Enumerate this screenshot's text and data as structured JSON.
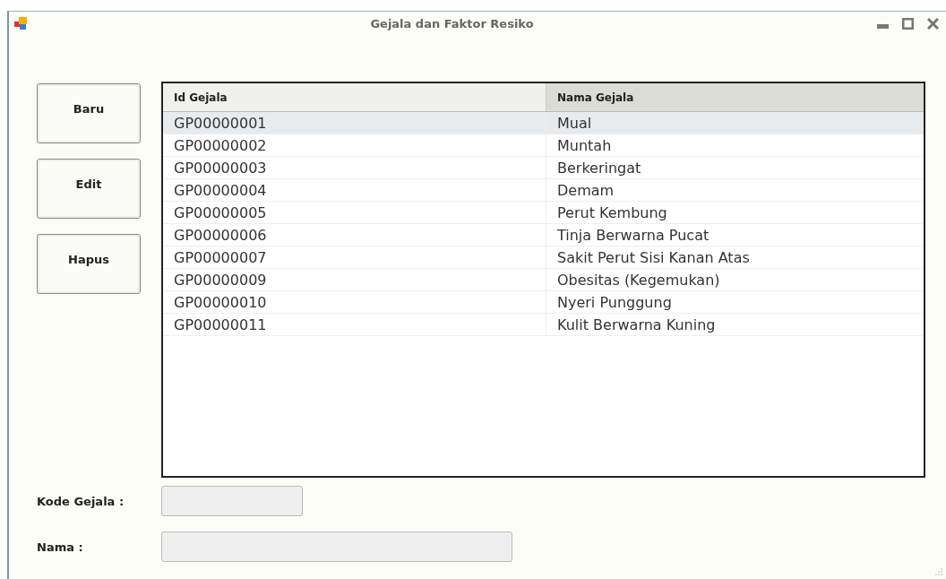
{
  "window": {
    "title": "Gejala dan Faktor Resiko"
  },
  "buttons": [
    "Baru",
    "Edit",
    "Hapus"
  ],
  "table": {
    "columns": [
      "Id Gejala",
      "Nama Gejala"
    ],
    "rows": [
      {
        "cells": [
          "GP00000001",
          "Mual"
        ],
        "selected": true
      },
      {
        "cells": [
          "GP00000002",
          "Muntah"
        ],
        "selected": false
      },
      {
        "cells": [
          "GP00000003",
          "Berkeringat"
        ],
        "selected": false
      },
      {
        "cells": [
          "GP00000004",
          "Demam"
        ],
        "selected": false
      },
      {
        "cells": [
          "GP00000005",
          "Perut Kembung"
        ],
        "selected": false
      },
      {
        "cells": [
          "GP00000006",
          "Tinja Berwarna Pucat"
        ],
        "selected": false
      },
      {
        "cells": [
          "GP00000007",
          "Sakit Perut Sisi Kanan Atas"
        ],
        "selected": false
      },
      {
        "cells": [
          "GP00000009",
          "Obesitas (Kegemukan)"
        ],
        "selected": false
      },
      {
        "cells": [
          "GP00000010",
          "Nyeri Punggung"
        ],
        "selected": false
      },
      {
        "cells": [
          "GP00000011",
          "Kulit Berwarna Kuning"
        ],
        "selected": false
      }
    ]
  },
  "fields": [
    {
      "label": "Kode Gejala :",
      "disabled": true
    },
    {
      "label": "Nama :",
      "disabled": true
    }
  ]
}
